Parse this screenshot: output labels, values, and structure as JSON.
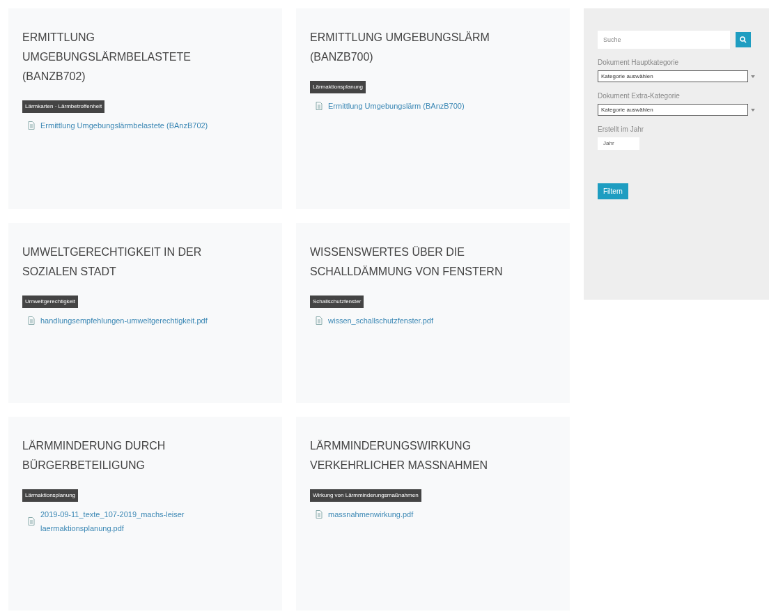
{
  "cards": [
    {
      "title": "ERMITTLUNG UMGEBUNGSLÄRMBELASTETE (BANZB702)",
      "tag": "Lärmkarten · Lärmbetroffenheit",
      "files": [
        "Ermittlung Umgebungslärmbelastete (BAnzB702)"
      ]
    },
    {
      "title": "ERMITTLUNG UMGEBUNGSLÄRM (BANZB700)",
      "tag": "Lärmaktionsplanung",
      "files": [
        "Ermittlung Umgebungslärm (BAnzB700)"
      ]
    },
    {
      "title": "UMWELTGERECHTIGKEIT IN DER SOZIALEN STADT",
      "tag": "Umweltgerechtigkeit",
      "files": [
        "handlungsempfehlungen-umweltgerechtigkeit.pdf"
      ]
    },
    {
      "title": "WISSENSWERTES ÜBER DIE SCHALLDÄMMUNG VON FENSTERN",
      "tag": "Schallschutzfenster",
      "files": [
        "wissen_schallschutzfenster.pdf"
      ]
    },
    {
      "title": "LÄRMMINDERUNG DURCH BÜRGERBETEILIGUNG",
      "tag": "Lärmaktionsplanung",
      "files": [
        "2019-09-11_texte_107-2019_machs-leiser laermaktionsplanung.pdf"
      ]
    },
    {
      "title": "LÄRMMINDERUNGSWIRKUNG VERKEHRLICHER MASSNAHMEN",
      "tag": "Wirkung von Lärmminderungsmaßnahmen",
      "files": [
        "massnahmenwirkung.pdf"
      ]
    }
  ],
  "sidebar": {
    "search": {
      "placeholder": "Suche"
    },
    "filters": [
      {
        "label": "Dokument Hauptkategorie",
        "value": "Kategorie auswählen",
        "kind": "wide"
      },
      {
        "label": "Dokument Extra-Kategorie",
        "value": "Kategorie auswählen",
        "kind": "wide"
      },
      {
        "label": "Erstellt im Jahr",
        "value": "Jahr",
        "kind": "small"
      }
    ],
    "button": "Filtern"
  }
}
